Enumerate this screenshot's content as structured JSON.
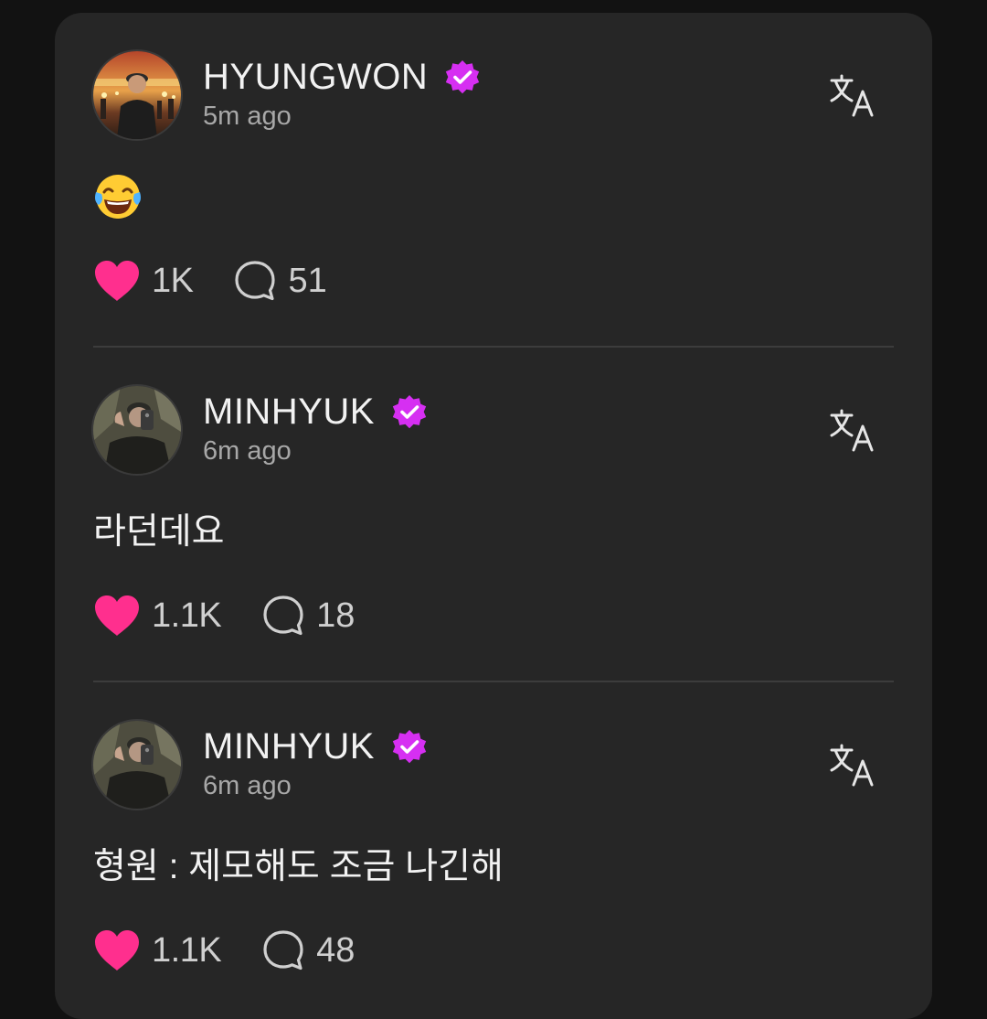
{
  "colors": {
    "background": "#121212",
    "card": "#262626",
    "divider": "#3c3c3c",
    "verified_badge": "#d62ff2",
    "heart": "#ff2f8e",
    "text_primary": "#f2f2f2",
    "text_secondary": "#a8a8a8"
  },
  "icons": {
    "verified": "verified-badge-icon",
    "translate": "translate-icon",
    "like": "heart-icon",
    "comment": "comment-bubble-icon"
  },
  "posts": [
    {
      "username": "HYUNGWON",
      "verified": true,
      "time": "5m ago",
      "content": "😂",
      "content_is_emoji": true,
      "likes": "1K",
      "comments": "51"
    },
    {
      "username": "MINHYUK",
      "verified": true,
      "time": "6m ago",
      "content": "라던데요",
      "content_is_emoji": false,
      "likes": "1.1K",
      "comments": "18"
    },
    {
      "username": "MINHYUK",
      "verified": true,
      "time": "6m ago",
      "content": "형원 : 제모해도 조금 나긴해",
      "content_is_emoji": false,
      "likes": "1.1K",
      "comments": "48"
    }
  ]
}
